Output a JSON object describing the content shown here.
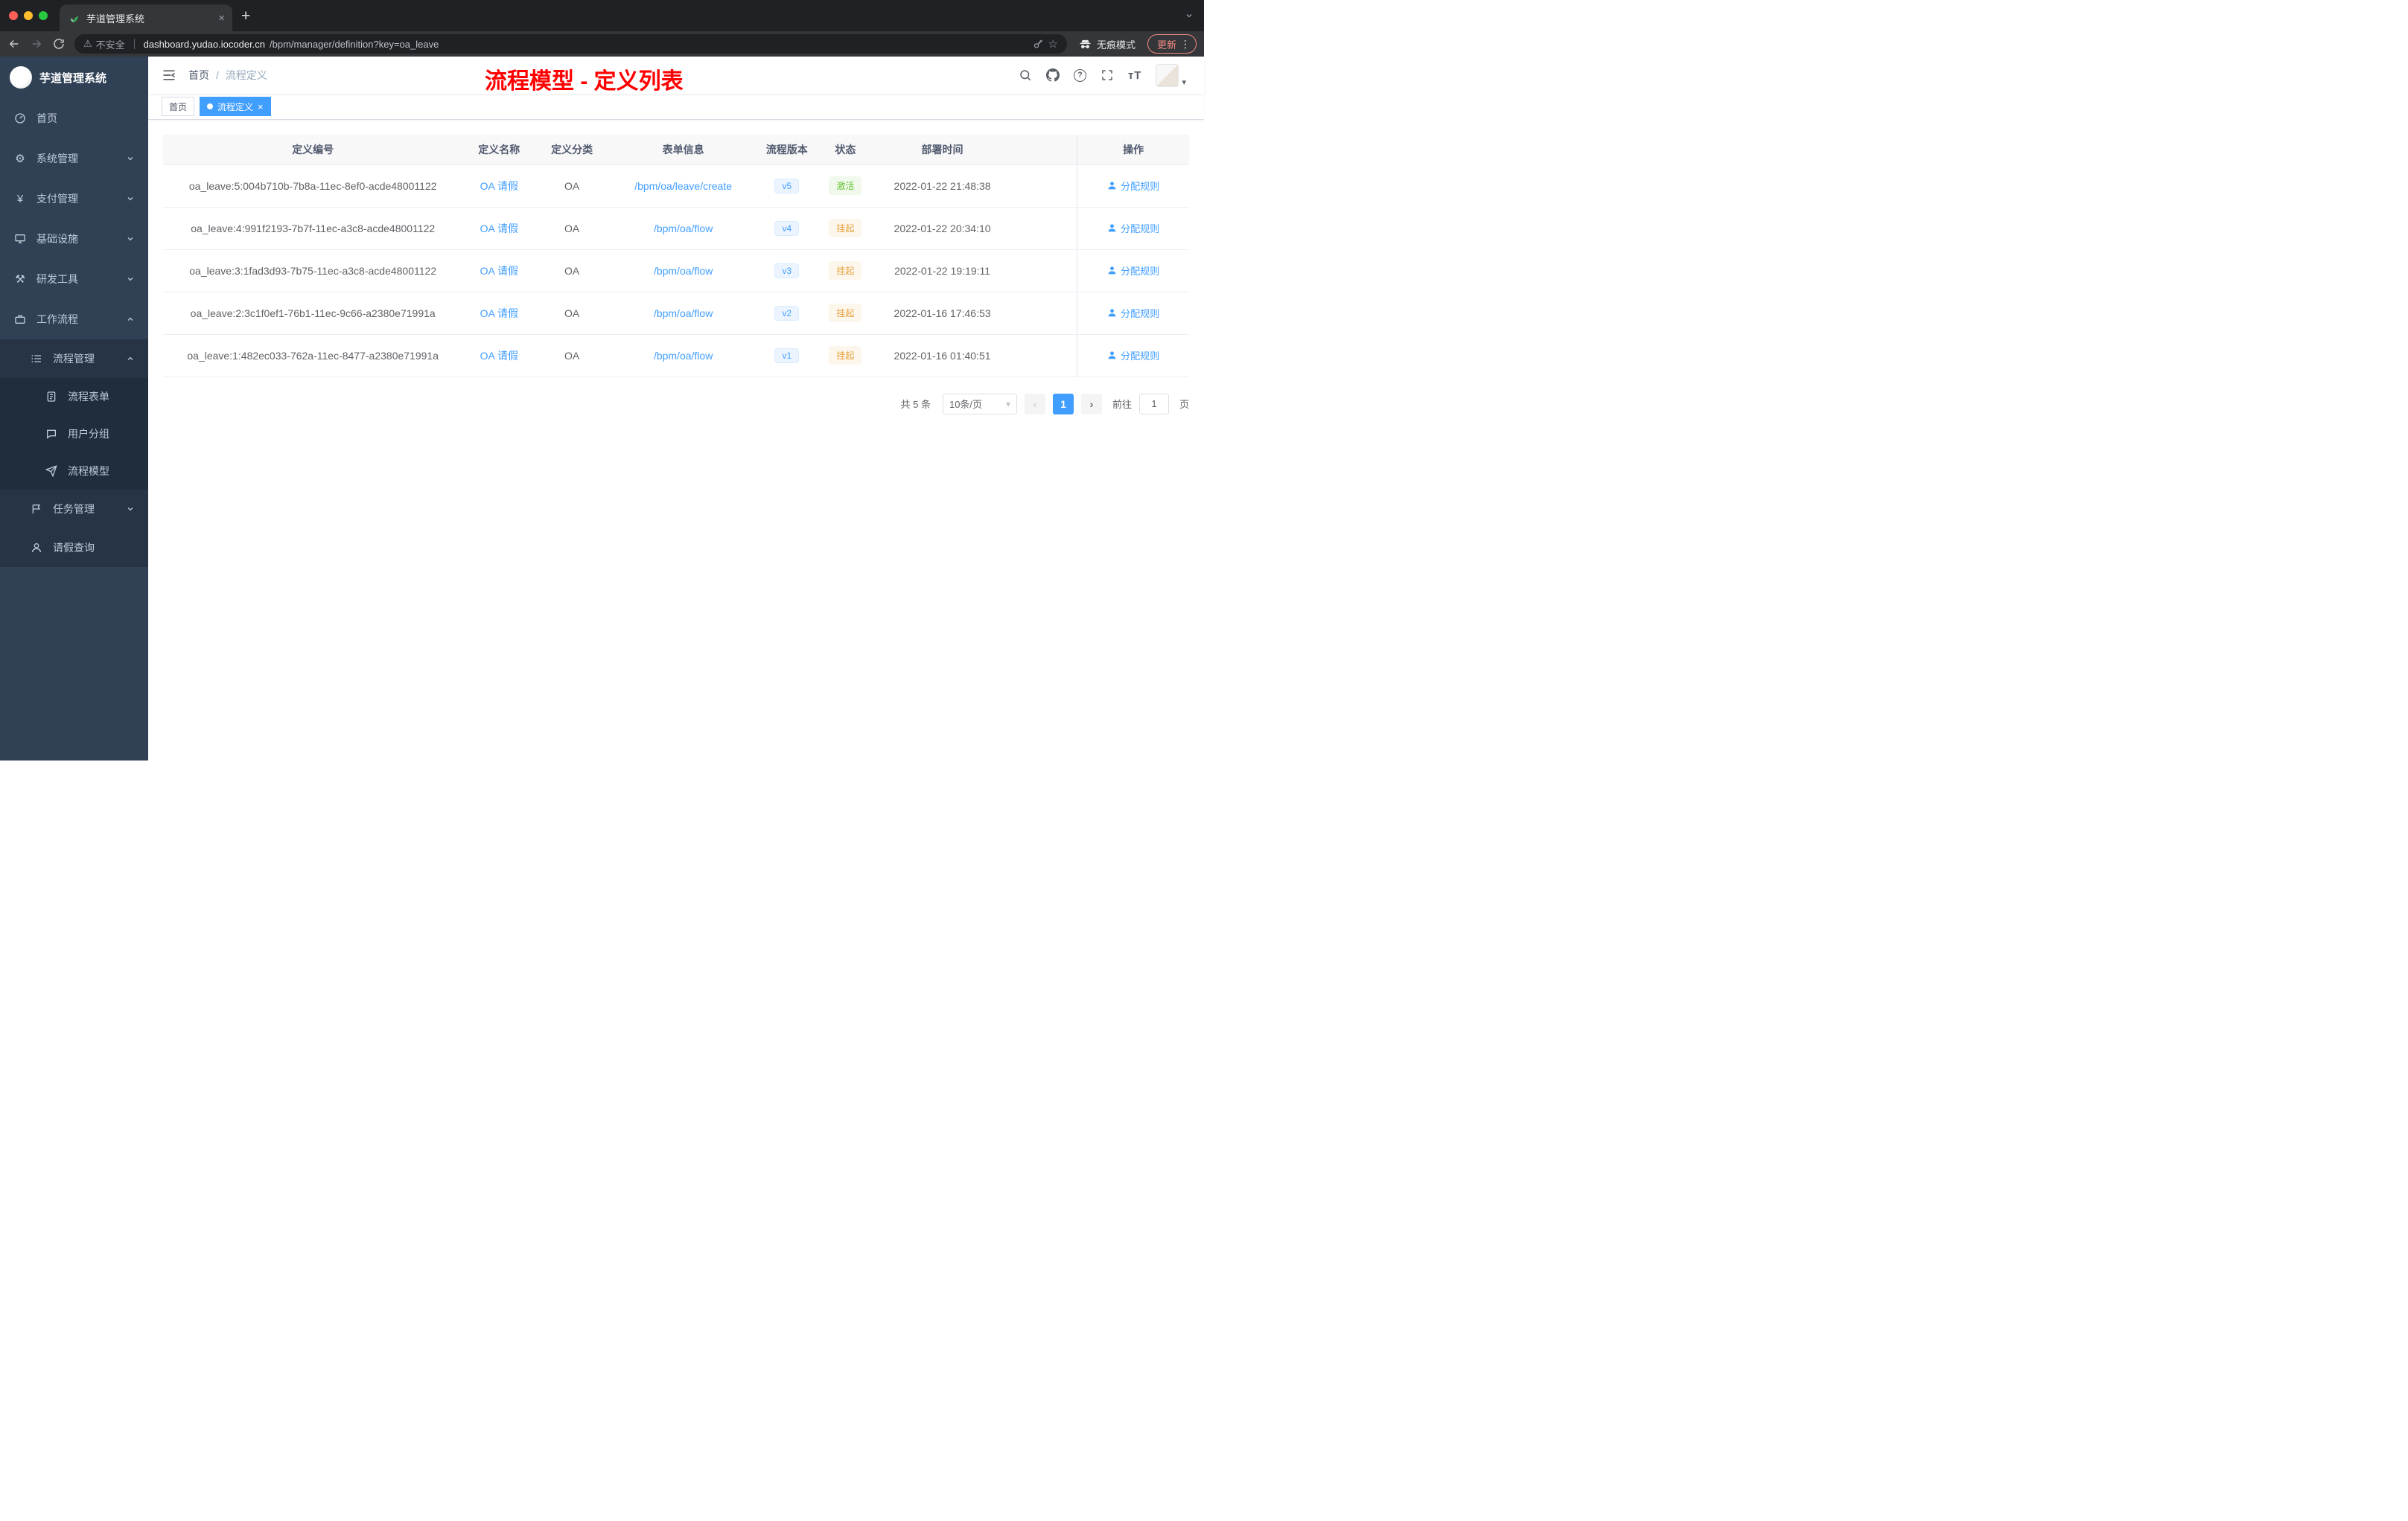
{
  "colors": {
    "accent": "#409eff",
    "success_text": "#67c23a",
    "success_bg": "#f0f9eb",
    "warning_text": "#e6a23c",
    "warning_bg": "#fdf6ec",
    "annotation_red": "#ff0000",
    "sidebar_bg": "#304156"
  },
  "icons": {
    "close": "×",
    "plus": "+",
    "kebab": "⋮",
    "star": "☆",
    "warning": "⚠",
    "gear": "⚙",
    "tools": "⚒",
    "yen": "¥",
    "question": "?",
    "chevron_left": "‹",
    "chevron_right": "›",
    "caret_down": "▾",
    "font_size": "тT"
  },
  "browser": {
    "tab_title": "芋道管理系统",
    "insecure_label": "不安全",
    "url_host": "dashboard.yudao.iocoder.cn",
    "url_path": "/bpm/manager/definition?key=oa_leave",
    "incognito_label": "无痕模式",
    "update_label": "更新"
  },
  "sidebar": {
    "logo_title": "芋道管理系统",
    "home": "首页",
    "system": "系统管理",
    "payment": "支付管理",
    "infra": "基础设施",
    "devtools": "研发工具",
    "workflow": "工作流程",
    "process_mgmt": "流程管理",
    "process_form": "流程表单",
    "user_group": "用户分组",
    "process_model": "流程模型",
    "task_mgmt": "任务管理",
    "leave_query": "请假查询"
  },
  "header": {
    "breadcrumb_home": "首页",
    "breadcrumb_sep": "/",
    "breadcrumb_current": "流程定义",
    "annotation": "流程模型 - 定义列表"
  },
  "tags": {
    "home": "首页",
    "current": "流程定义"
  },
  "table": {
    "columns": [
      "定义编号",
      "定义名称",
      "定义分类",
      "表单信息",
      "流程版本",
      "状态",
      "部署时间",
      "操作"
    ],
    "rows": [
      {
        "id": "oa_leave:5:004b710b-7b8a-11ec-8ef0-acde48001122",
        "name": "OA 请假",
        "category": "OA",
        "form": "/bpm/oa/leave/create",
        "version": "v5",
        "status": "激活",
        "status_type": "success",
        "time": "2022-01-22 21:48:38",
        "action": "分配规则"
      },
      {
        "id": "oa_leave:4:991f2193-7b7f-11ec-a3c8-acde48001122",
        "name": "OA 请假",
        "category": "OA",
        "form": "/bpm/oa/flow",
        "version": "v4",
        "status": "挂起",
        "status_type": "warning",
        "time": "2022-01-22 20:34:10",
        "action": "分配规则"
      },
      {
        "id": "oa_leave:3:1fad3d93-7b75-11ec-a3c8-acde48001122",
        "name": "OA 请假",
        "category": "OA",
        "form": "/bpm/oa/flow",
        "version": "v3",
        "status": "挂起",
        "status_type": "warning",
        "time": "2022-01-22 19:19:11",
        "action": "分配规则"
      },
      {
        "id": "oa_leave:2:3c1f0ef1-76b1-11ec-9c66-a2380e71991a",
        "name": "OA 请假",
        "category": "OA",
        "form": "/bpm/oa/flow",
        "version": "v2",
        "status": "挂起",
        "status_type": "warning",
        "time": "2022-01-16 17:46:53",
        "action": "分配规则"
      },
      {
        "id": "oa_leave:1:482ec033-762a-11ec-8477-a2380e71991a",
        "name": "OA 请假",
        "category": "OA",
        "form": "/bpm/oa/flow",
        "version": "v1",
        "status": "挂起",
        "status_type": "warning",
        "time": "2022-01-16 01:40:51",
        "action": "分配规则"
      }
    ]
  },
  "pagination": {
    "total": "共 5 条",
    "page_size": "10条/页",
    "current": "1",
    "goto_prefix": "前往",
    "goto_value": "1",
    "goto_suffix": "页"
  }
}
